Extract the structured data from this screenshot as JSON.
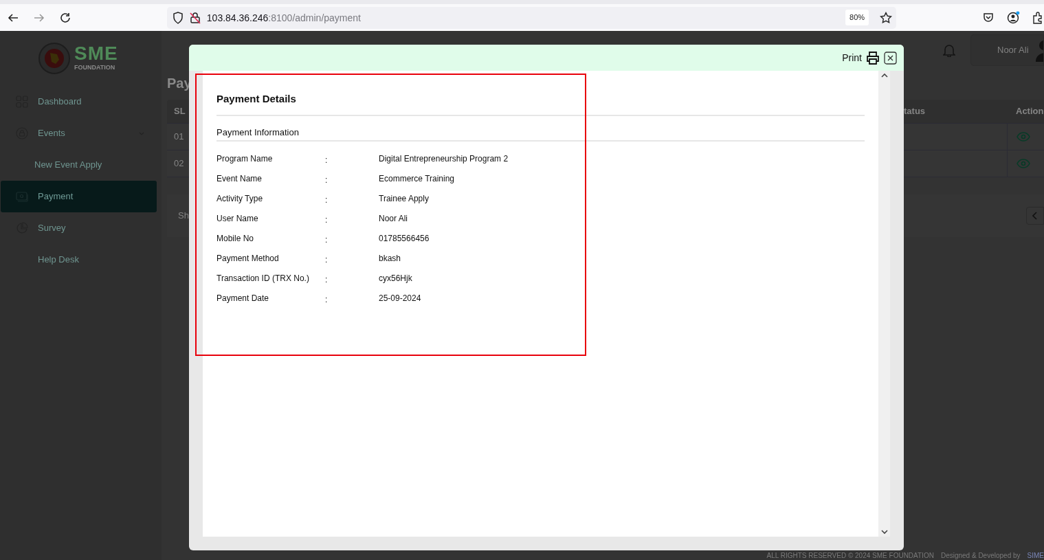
{
  "browser": {
    "url_host": "103.84.36.246",
    "url_path": ":8100/admin/payment",
    "zoom": "80%"
  },
  "logo": {
    "name": "SME",
    "subtitle": "FOUNDATION"
  },
  "sidebar": {
    "items": [
      {
        "label": "Dashboard",
        "kind": "link",
        "selected": false
      },
      {
        "label": "Events",
        "kind": "group",
        "selected": false,
        "expanded": true
      },
      {
        "label": "New Event Apply",
        "kind": "sub",
        "selected": false
      },
      {
        "label": "Payment",
        "kind": "link",
        "selected": true
      },
      {
        "label": "Survey",
        "kind": "link",
        "selected": false
      },
      {
        "label": "Help Desk",
        "kind": "plain",
        "selected": false
      }
    ]
  },
  "header": {
    "user_name": "Noor Ali"
  },
  "page_title": "Pay",
  "table": {
    "columns": [
      "SL",
      "tatus",
      "Action"
    ],
    "rows": [
      {
        "sl": "01"
      },
      {
        "sl": "02"
      }
    ]
  },
  "pager_card": {
    "text": "Sh"
  },
  "footer": {
    "copyright": "ALL RIGHTS RESERVED © 2024 SME FOUNDATION",
    "credit": "Designed & Developed by",
    "credit_link": "SIME"
  },
  "modal": {
    "print_label": "Print",
    "title": "Payment Details",
    "section": "Payment Information",
    "fields": [
      {
        "label": "Program Name",
        "separator": ":",
        "value": "Digital Entrepreneurship Program 2"
      },
      {
        "label": "Event Name",
        "separator": ":",
        "value": "Ecommerce Training"
      },
      {
        "label": "Activity Type",
        "separator": ":",
        "value": "Trainee Apply"
      },
      {
        "label": "User Name",
        "separator": ":",
        "value": "Noor Ali"
      },
      {
        "label": "Mobile No",
        "separator": ":",
        "value": "01785566456"
      },
      {
        "label": "Payment Method",
        "separator": ":",
        "value": "bkash"
      },
      {
        "label": "Transaction ID (TRX No.)",
        "separator": ":",
        "value": "cyx56Hjk"
      },
      {
        "label": "Payment Date",
        "separator": ":",
        "value": "25-09-2024"
      }
    ]
  }
}
